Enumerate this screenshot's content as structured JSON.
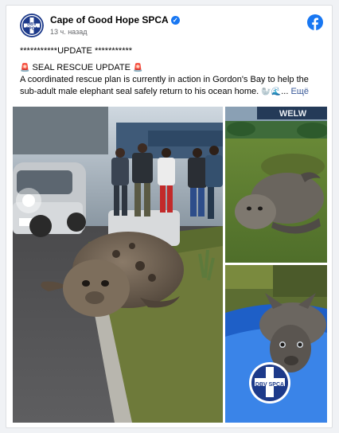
{
  "post": {
    "page_name": "Cape of Good Hope SPCA",
    "timestamp": "13 ч. назад",
    "text_line1": "***********UPDATE ***********",
    "text_heading": "SEAL RESCUE UPDATE",
    "text_body": "A coordinated rescue plan is currently in action in Gordon's Bay to help the sub-adult male elephant seal safely return to his ocean home.",
    "see_more": "Ещё"
  },
  "photos": {
    "sign_text": "WELW",
    "vehicle_logo": "DBV SPCA"
  },
  "avatar": {
    "logo_line1": "DBV",
    "logo_line2": "SPCA"
  },
  "colors": {
    "brand_blue": "#1877f2",
    "spca_navy": "#1d3a8a",
    "link": "#385898"
  },
  "icons": {
    "verified": "verified-check-icon",
    "facebook": "facebook-logo-icon",
    "siren": "siren-icon"
  }
}
